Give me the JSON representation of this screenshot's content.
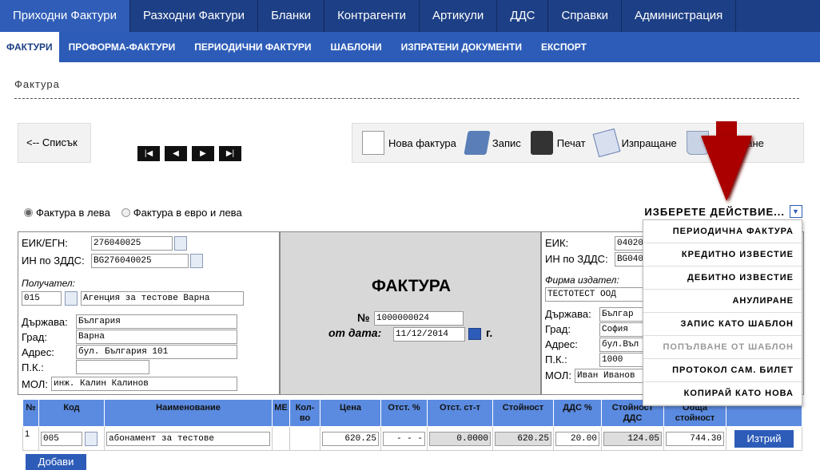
{
  "topnav": [
    "Приходни Фактури",
    "Разходни Фактури",
    "Бланки",
    "Контрагенти",
    "Артикули",
    "ДДС",
    "Справки",
    "Администрация"
  ],
  "subnav": [
    "ФАКТУРИ",
    "ПРОФОРМА-ФАКТУРИ",
    "ПЕРИОДИЧНИ ФАКТУРИ",
    "ШАБЛОНИ",
    "ИЗПРАТЕНИ ДОКУМЕНТИ",
    "ЕКСПОРТ"
  ],
  "page_title": "Фактура",
  "back_label": "<--  Списък",
  "pager": [
    "|◀",
    "◀",
    "▶",
    "▶|"
  ],
  "toolbar": {
    "new": "Нова фактура",
    "save": "Запис",
    "print": "Печат",
    "send": "Изпращане",
    "delete": "Изтриване"
  },
  "currency": {
    "bgn": "Фактура в лева",
    "eur": "Фактура в евро и лева"
  },
  "action_select": "ИЗБЕРЕТЕ ДЕЙСТВИЕ...",
  "actions": [
    "ПЕРИОДИЧНА ФАКТУРА",
    "КРЕДИТНО ИЗВЕСТИЕ",
    "ДЕБИТНО ИЗВЕСТИЕ",
    "АНУЛИРАНЕ",
    "ЗАПИС КАТО ШАБЛОН",
    "ПОПЪЛВАНЕ ОТ ШАБЛОН",
    "ПРОТОКОЛ САМ. БИЛЕТ",
    "КОПИРАЙ КАТО НОВА"
  ],
  "recipient": {
    "eik_label": "ЕИК/ЕГН:",
    "eik": "276040025",
    "vat_label": "ИН по ЗДДС:",
    "vat": "BG276040025",
    "recipient_label": "Получател:",
    "code": "015",
    "name": "Агенция за тестове Варна",
    "country_label": "Държава:",
    "country": "България",
    "city_label": "Град:",
    "city": "Варна",
    "address_label": "Адрес:",
    "address": "бул. България 101",
    "zip_label": "П.К.:",
    "zip": "",
    "mol_label": "МОЛ:",
    "mol": "инж. Калин Калинов"
  },
  "invoice": {
    "title": "ФАКТУРА",
    "no_label": "№",
    "no": "1000000024",
    "date_label": "от дата:",
    "date": "11/12/2014",
    "year_suffix": "г."
  },
  "issuer": {
    "eik_label": "ЕИК:",
    "eik": "04020",
    "vat_label": "ИН по ЗДДС:",
    "vat": "BG040",
    "issuer_label": "Фирма издател:",
    "name": "ТЕСТОТЕСТ ООД",
    "country_label": "Държава:",
    "country": "Българ",
    "city_label": "Град:",
    "city": "София",
    "address_label": "Адрес:",
    "address": "бул.Въл",
    "zip_label": "П.К.:",
    "zip": "1000",
    "mol_label": "МОЛ:",
    "mol": "Иван Иванов"
  },
  "table": {
    "headers": [
      "№",
      "Код",
      "Наименование",
      "МЕ",
      "Кол-во",
      "Цена",
      "Отст. %",
      "Отст. ст-т",
      "Стойност",
      "ДДС %",
      "Стойност ДДС",
      "Обща стойност",
      ""
    ],
    "row": {
      "num": "1",
      "code": "005",
      "name": "абонамент за тестове",
      "unit": "",
      "qty": "",
      "price": "620.25",
      "disc_pct": "- - -",
      "disc_val": "0.0000",
      "value": "620.25",
      "vat_pct": "20.00",
      "vat_value": "124.05",
      "total": "744.30",
      "delete": "Изтрий"
    }
  },
  "add_label": "Добави"
}
